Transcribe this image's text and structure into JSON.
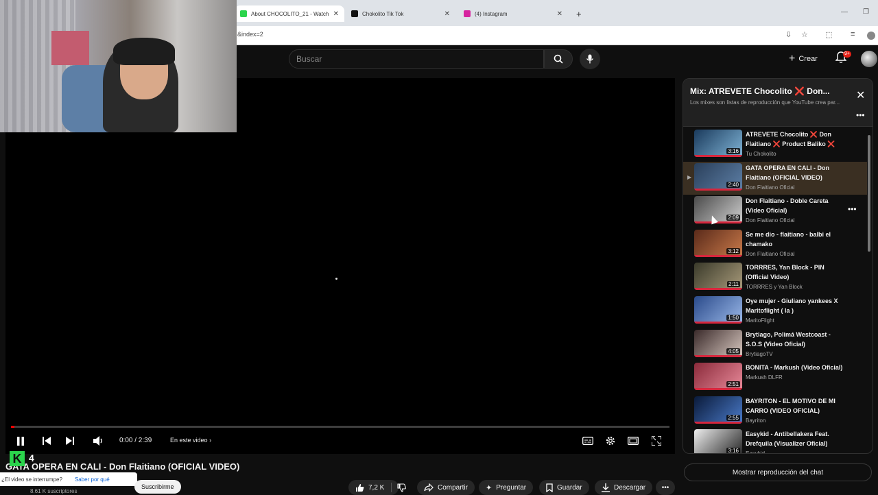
{
  "browser": {
    "tabs": [
      {
        "title": "About CHOCOLITO_21 - Watch",
        "favicon_color": "#2bd44c"
      },
      {
        "title": "Chokolito Tik Tok",
        "favicon_color": "#111111"
      },
      {
        "title": "(4) Instagram",
        "favicon_color": "#d6249f"
      }
    ],
    "new_tab": "+",
    "url": "&index=2"
  },
  "header": {
    "search_placeholder": "Buscar",
    "create_label": "Crear",
    "notif_badge": "9+"
  },
  "player": {
    "time": "0:00 / 2:39",
    "chapter": "En este video",
    "progress": 0.005
  },
  "below": {
    "title": "GATA OPERA EN CALI - Don Flaitiano (OFICIAL VIDEO)",
    "channel_short": "4",
    "views": "8.61 K suscriptores",
    "interrupt_question": "¿El video se interrumpe?",
    "interrupt_link": "Saber por qué",
    "subscribe": "Suscribirme",
    "likes": "7,2 K",
    "share": "Compartir",
    "ask": "Preguntar",
    "save": "Guardar",
    "download": "Descargar"
  },
  "playlist": {
    "title": "Mix: ATREVETE Chocolito ❌ Don...",
    "subtitle": "Los mixes son listas de reproducción que YouTube crea par...",
    "chat_button": "Mostrar reproducción del chat",
    "items": [
      {
        "idx": "",
        "title": "ATREVETE Chocolito ❌ Don Flaitiano ❌ Product Baliko ❌",
        "channel": "Tu Chokolito",
        "duration": "3:16",
        "colors": [
          "#1a3a5c",
          "#7fb3d5"
        ]
      },
      {
        "idx": "▶",
        "title": "GATA OPERA EN CALI - Don Flaitiano (OFICIAL VIDEO)",
        "channel": "Don Flaitiano Oficial",
        "duration": "2:40",
        "colors": [
          "#2a3f5a",
          "#5d7fa6"
        ]
      },
      {
        "idx": "",
        "title": "Don Flaitiano - Doble Careta (Video Oficial)",
        "channel": "Don Flaitiano Oficial",
        "duration": "2:09",
        "colors": [
          "#4a4a4a",
          "#cfcfcf"
        ]
      },
      {
        "idx": "",
        "title": "Se me dio - flaitiano - balbi el chamako",
        "channel": "Don Flaitiano Oficial",
        "duration": "3:12",
        "colors": [
          "#5a2a1a",
          "#c97a4a"
        ]
      },
      {
        "idx": "",
        "title": "TORRRES, Yan Block - PIN (Official Video)",
        "channel": "TORRRES y Yan Block",
        "duration": "2:11",
        "colors": [
          "#3a3a2a",
          "#a89a7a"
        ]
      },
      {
        "idx": "",
        "title": "Oye mujer - Giuliano yankees X Maritoflight ( la )",
        "channel": "MaritoFlight",
        "duration": "1:50",
        "colors": [
          "#2a4a8a",
          "#9ab8e8"
        ]
      },
      {
        "idx": "",
        "title": "Brytiago, Polimá Westcoast - S.O.S (Video Oficial)",
        "channel": "BrytiagoTV",
        "duration": "4:05",
        "colors": [
          "#3a2a2a",
          "#d8c8c0"
        ]
      },
      {
        "idx": "",
        "title": "BONITA - Markush (Video Oficial)",
        "channel": "Markush DLFR",
        "duration": "2:51",
        "colors": [
          "#8a2a3a",
          "#e88a9a"
        ]
      },
      {
        "idx": "",
        "title": "BAYRITON - EL MOTIVO DE MI CARRO (VIDEO OFICIAL)",
        "channel": "Bayriton",
        "duration": "2:55",
        "colors": [
          "#0a1a3a",
          "#4a7ac8"
        ]
      },
      {
        "idx": "",
        "title": "Easykid - Antibellakera Feat. Drefquila (Visualizer Oficial)",
        "channel": "Easykid",
        "duration": "3:16",
        "colors": [
          "#eeeeee",
          "#222222"
        ]
      }
    ]
  }
}
